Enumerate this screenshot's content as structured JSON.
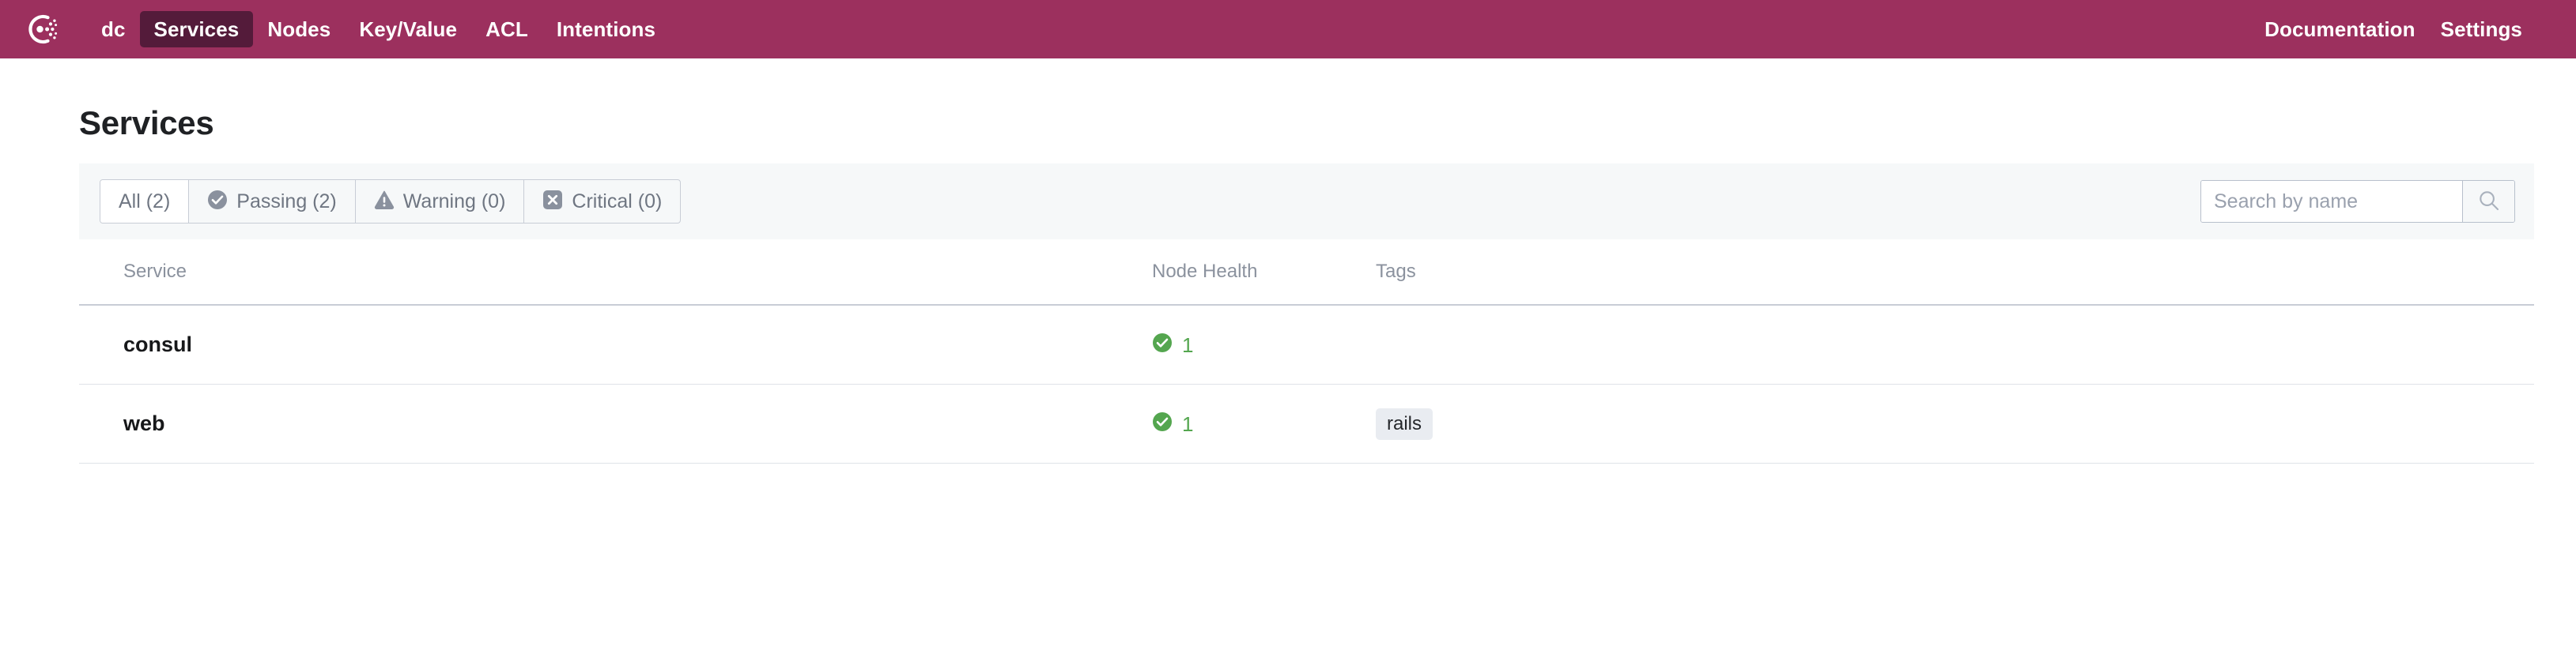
{
  "navbar": {
    "logo_icon": "consul-logo-icon",
    "brand_color": "#9c305e",
    "active_color": "#541b3a",
    "left_items": [
      {
        "label": "dc",
        "active": false,
        "name": "datacenter"
      },
      {
        "label": "Services",
        "active": true,
        "name": "services"
      },
      {
        "label": "Nodes",
        "active": false,
        "name": "nodes"
      },
      {
        "label": "Key/Value",
        "active": false,
        "name": "key-value"
      },
      {
        "label": "ACL",
        "active": false,
        "name": "acl"
      },
      {
        "label": "Intentions",
        "active": false,
        "name": "intentions"
      }
    ],
    "right_items": [
      {
        "label": "Documentation",
        "name": "documentation"
      },
      {
        "label": "Settings",
        "name": "settings"
      }
    ]
  },
  "page": {
    "title": "Services"
  },
  "filters": {
    "tabs": [
      {
        "label": "All (2)",
        "icon": "none",
        "active": true,
        "name": "all"
      },
      {
        "label": "Passing (2)",
        "icon": "check-circle-icon",
        "active": false,
        "name": "passing"
      },
      {
        "label": "Warning (0)",
        "icon": "warning-triangle-icon",
        "active": false,
        "name": "warning"
      },
      {
        "label": "Critical (0)",
        "icon": "x-square-icon",
        "active": false,
        "name": "critical"
      }
    ]
  },
  "search": {
    "placeholder": "Search by name",
    "value": "",
    "button_icon": "search-icon"
  },
  "table": {
    "headers": {
      "service": "Service",
      "node_health": "Node Health",
      "tags": "Tags"
    },
    "rows": [
      {
        "service": "consul",
        "health_status": "passing",
        "health_count": "1",
        "health_color": "#54a64f",
        "tags": []
      },
      {
        "service": "web",
        "health_status": "passing",
        "health_count": "1",
        "health_color": "#54a64f",
        "tags": [
          "rails"
        ]
      }
    ]
  }
}
